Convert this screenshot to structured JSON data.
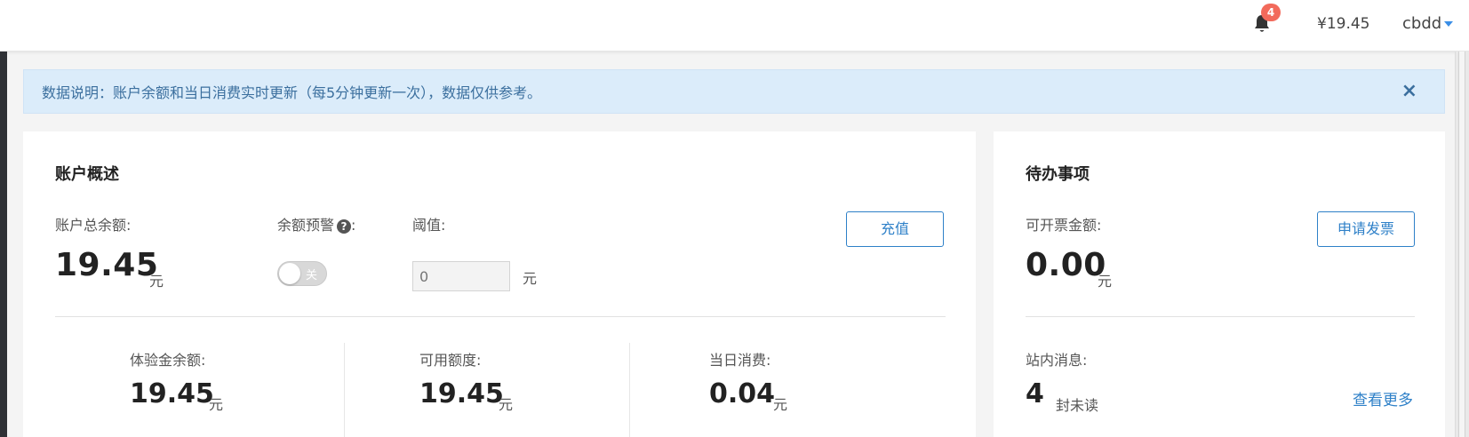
{
  "header": {
    "notification_count": "4",
    "balance": "¥19.45",
    "username": "cbdd"
  },
  "alert": {
    "text": "数据说明：账户余额和当日消费实时更新（每5分钟更新一次），数据仅供参考。",
    "close_symbol": "×"
  },
  "overview": {
    "title": "账户概述",
    "total_balance_label": "账户总余额:",
    "total_balance_value": "19.45",
    "unit": "元",
    "balance_alert_label": "余额预警",
    "balance_alert_colon": ":",
    "toggle_state": "关",
    "threshold_label": "阈值:",
    "threshold_placeholder": "0",
    "recharge_button": "充值",
    "trial_balance_label": "体验金余额:",
    "trial_balance_value": "19.45",
    "available_credit_label": "可用额度:",
    "available_credit_value": "19.45",
    "daily_spend_label": "当日消费:",
    "daily_spend_value": "0.04"
  },
  "todo": {
    "title": "待办事项",
    "invoice_amount_label": "可开票金额:",
    "invoice_amount_value": "0.00",
    "unit": "元",
    "apply_invoice_button": "申请发票",
    "messages_label": "站内消息:",
    "unread_count": "4",
    "unread_suffix": "封未读",
    "view_more_link": "查看更多"
  },
  "colors": {
    "accent": "#2e80c8",
    "alert_bg": "#dbecfa",
    "badge": "#f26a5b"
  }
}
